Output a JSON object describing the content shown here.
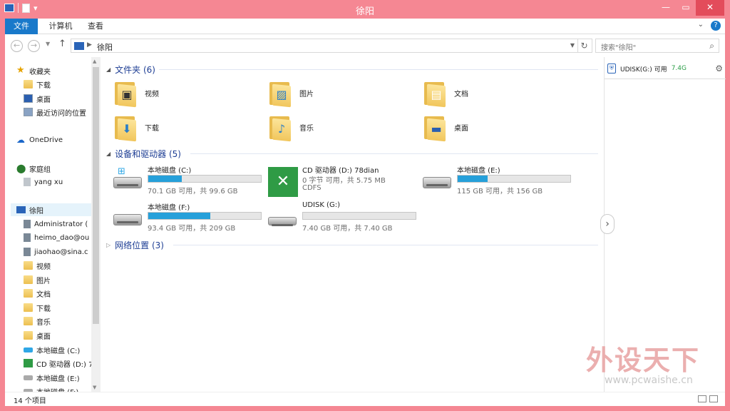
{
  "window": {
    "title": "徐阳"
  },
  "ribbon": {
    "tabs": [
      {
        "label": "文件"
      },
      {
        "label": "计算机"
      },
      {
        "label": "查看"
      }
    ]
  },
  "address": {
    "path": "徐阳",
    "search_placeholder": "搜索\"徐阳\""
  },
  "nav": {
    "items": [
      {
        "label": "收藏夹",
        "icon": "star-icon"
      },
      {
        "label": "下载",
        "icon": "downloads-folder-icon"
      },
      {
        "label": "桌面",
        "icon": "desktop-icon"
      },
      {
        "label": "最近访问的位置",
        "icon": "recent-places-icon"
      },
      {
        "label": "OneDrive",
        "icon": "onedrive-cloud-icon"
      },
      {
        "label": "家庭组",
        "icon": "homegroup-icon"
      },
      {
        "label": "yang xu",
        "icon": "user-icon"
      },
      {
        "label": "徐阳",
        "icon": "computer-icon"
      },
      {
        "label": "Administrator (",
        "icon": "user-icon"
      },
      {
        "label": "heimo_dao@ou",
        "icon": "user-icon"
      },
      {
        "label": "jiaohao@sina.c",
        "icon": "user-icon"
      },
      {
        "label": "视频",
        "icon": "videos-folder-icon"
      },
      {
        "label": "图片",
        "icon": "pictures-folder-icon"
      },
      {
        "label": "文档",
        "icon": "documents-folder-icon"
      },
      {
        "label": "下载",
        "icon": "downloads-folder-icon"
      },
      {
        "label": "音乐",
        "icon": "music-folder-icon"
      },
      {
        "label": "桌面",
        "icon": "desktop-folder-icon"
      },
      {
        "label": "本地磁盘 (C:)",
        "icon": "windows-drive-icon"
      },
      {
        "label": "CD 驱动器 (D:) 7",
        "icon": "cd-drive-icon"
      },
      {
        "label": "本地磁盘 (E:)",
        "icon": "hard-drive-icon"
      },
      {
        "label": "本地磁盘 (F:)",
        "icon": "hard-drive-icon"
      }
    ]
  },
  "groups": {
    "folders": {
      "title": "文件夹 (6)"
    },
    "drives": {
      "title": "设备和驱动器 (5)"
    },
    "network": {
      "title": "网络位置 (3)"
    }
  },
  "folders": [
    {
      "label": "视频",
      "icon": "videos-folder-icon"
    },
    {
      "label": "图片",
      "icon": "pictures-folder-icon"
    },
    {
      "label": "文档",
      "icon": "documents-folder-icon"
    },
    {
      "label": "下载",
      "icon": "downloads-folder-icon"
    },
    {
      "label": "音乐",
      "icon": "music-folder-icon"
    },
    {
      "label": "桌面",
      "icon": "desktop-folder-icon"
    }
  ],
  "drives": [
    {
      "name": "本地磁盘 (C:)",
      "info": "70.1 GB 可用，共 99.6 GB",
      "used_fraction": 0.296
    },
    {
      "name": "CD 驱动器 (D:) 78dian",
      "line2": "0 字节 可用，共 5.75 MB",
      "line3": "CDFS"
    },
    {
      "name": "本地磁盘 (E:)",
      "info": "115 GB 可用，共 156 GB",
      "used_fraction": 0.263
    },
    {
      "name": "本地磁盘 (F:)",
      "info": "93.4 GB 可用，共 209 GB",
      "used_fraction": 0.553
    },
    {
      "name": "UDISK (G:)",
      "info": "7.40 GB 可用，共 7.40 GB",
      "used_fraction": 0.0
    }
  ],
  "sidepane": {
    "usb_label": "UDISK(G:) 可用",
    "usb_free": "7.4G"
  },
  "status": {
    "count": "14 个项目"
  },
  "watermark": {
    "brand": "外设天下",
    "url": "www.pcwaishe.cn"
  },
  "colors": {
    "accent": "#1979ca",
    "title_bar": "#f58793",
    "usage_bar": "#26a0da",
    "group_title": "#1e3e94"
  }
}
